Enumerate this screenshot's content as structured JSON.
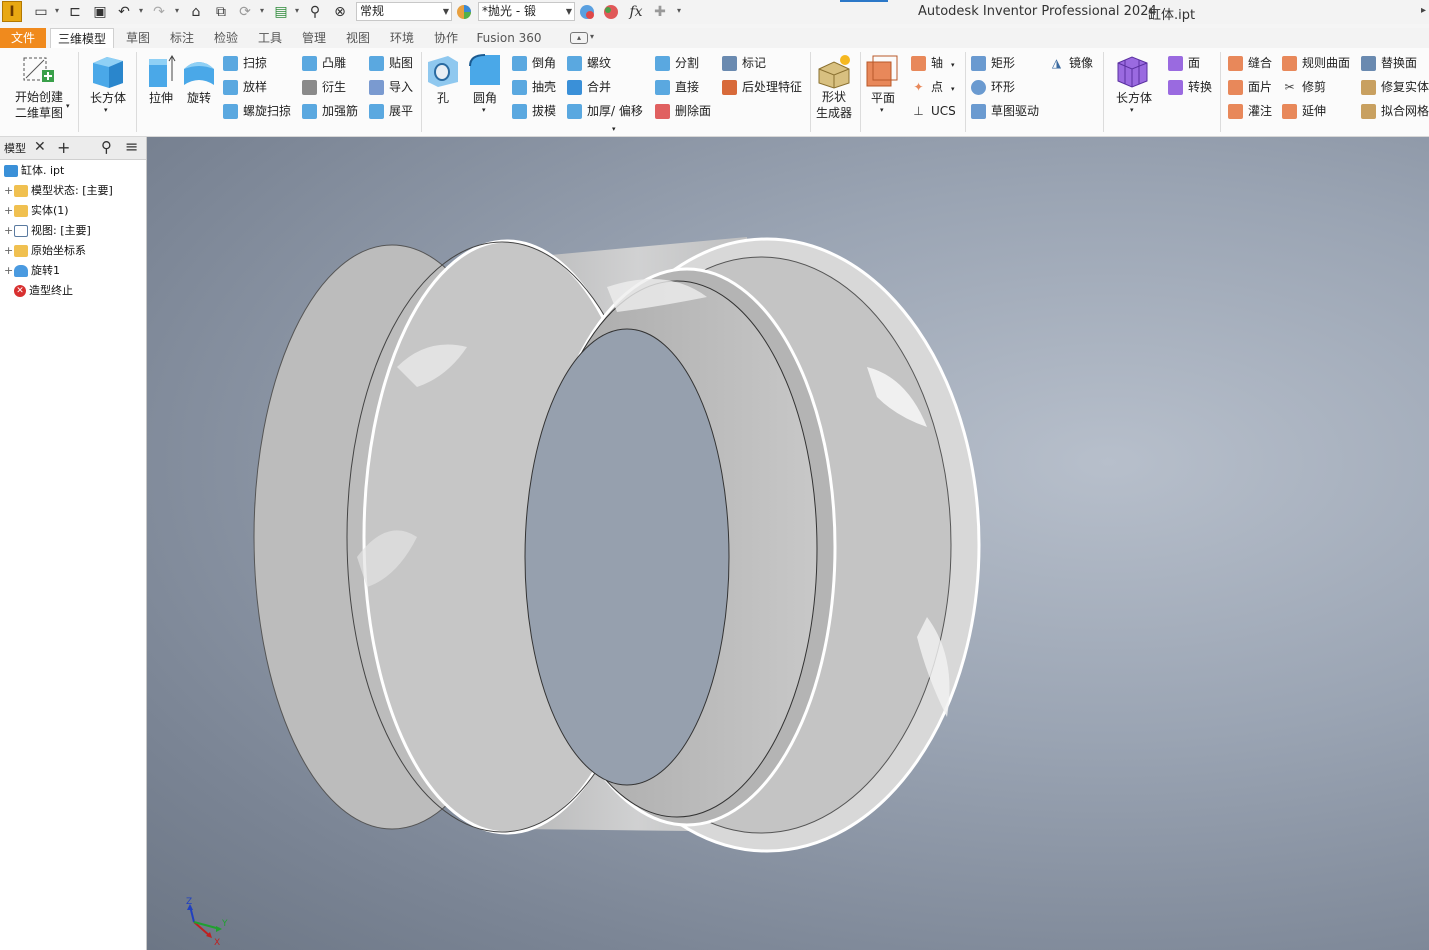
{
  "titlebar": {
    "logo_letter": "I",
    "appearance_combo": "常规",
    "material_combo": "*抛光 - 锻",
    "app_title": "Autodesk Inventor Professional 2024",
    "doc_title": "缸体.ipt"
  },
  "tabs": {
    "file": "文件",
    "model": "三维模型",
    "sketch": "草图",
    "annotate": "标注",
    "inspect": "检验",
    "tools": "工具",
    "manage": "管理",
    "view": "视图",
    "environments": "环境",
    "collaborate": "协作",
    "fusion": "Fusion 360"
  },
  "ribbon": {
    "start_sketch_l1": "开始创建",
    "start_sketch_l2": "二维草图",
    "box": "长方体",
    "extrude": "拉伸",
    "revolve": "旋转",
    "sweep": "扫掠",
    "loft": "放样",
    "coil": "螺旋扫掠",
    "emboss": "凸雕",
    "derive": "衍生",
    "rib": "加强筋",
    "decal": "贴图",
    "import": "导入",
    "unwrap": "展平",
    "hole": "孔",
    "fillet": "圆角",
    "chamfer": "倒角",
    "shell": "抽壳",
    "draft": "拔模",
    "thread": "螺纹",
    "combine": "合并",
    "thicken": "加厚/ 偏移",
    "split": "分割",
    "direct": "直接",
    "delete_face": "删除面",
    "mark": "标记",
    "post_process": "后处理特征",
    "shape_gen_l1": "形状",
    "shape_gen_l2": "生成器",
    "plane": "平面",
    "axis": "轴",
    "point": "点",
    "ucs": "UCS",
    "rect_pattern": "矩形",
    "circ_pattern": "环形",
    "sketch_driven": "草图驱动",
    "mirror": "镜像",
    "freeform_box": "长方体",
    "face": "面",
    "convert": "转换",
    "stitch": "缝合",
    "patch": "面片",
    "sculpt": "灌注",
    "ruled_surface": "规则曲面",
    "trim": "修剪",
    "extend": "延伸",
    "replace_face": "替换面",
    "repair_bodies": "修复实体",
    "fit_mesh": "拟合网格"
  },
  "browser": {
    "tab_label": "模型",
    "items": [
      {
        "label": "缸体. ipt",
        "has_plus": false
      },
      {
        "label": "模型状态: [主要]",
        "has_plus": true
      },
      {
        "label": "实体(1)",
        "has_plus": true
      },
      {
        "label": "视图: [主要]",
        "has_plus": true
      },
      {
        "label": "原始坐标系",
        "has_plus": true
      },
      {
        "label": "旋转1",
        "has_plus": true
      },
      {
        "label": "造型终止",
        "has_plus": false
      }
    ]
  },
  "triad": {
    "z": "Z",
    "x": "X",
    "y": "Y"
  },
  "colors": {
    "file_tab": "#f08a1d",
    "accent_blue": "#2b78c8",
    "viewport_bg": "#9aa4b3"
  }
}
